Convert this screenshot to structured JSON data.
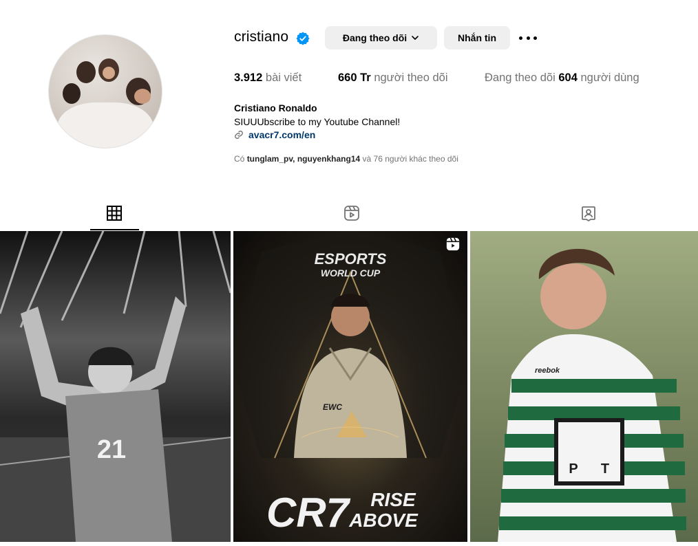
{
  "profile": {
    "username": "cristiano",
    "verified": true,
    "buttons": {
      "following": "Đang theo dõi",
      "message": "Nhắn tin"
    },
    "stats": {
      "posts_count": "3.912",
      "posts_label": "bài viết",
      "followers_count": "660 Tr",
      "followers_label": "người theo dõi",
      "following_prefix": "Đang theo dõi",
      "following_count": "604",
      "following_label": "người dùng"
    },
    "full_name": "Cristiano Ronaldo",
    "bio": "SIUUUbscribe to my Youtube Channel!",
    "link": "avacr7.com/en",
    "followed_by": {
      "prefix": "Có",
      "user1": "tunglam_pv",
      "sep": ",",
      "user2": "nguyenkhang14",
      "suffix": "và 76 người khác theo dõi"
    }
  },
  "tabs": [
    {
      "name": "posts",
      "icon": "grid-icon",
      "active": true
    },
    {
      "name": "reels",
      "icon": "reels-icon",
      "active": false
    },
    {
      "name": "tagged",
      "icon": "tagged-icon",
      "active": false
    }
  ],
  "grid": [
    {
      "type": "photo",
      "jersey_number": "21"
    },
    {
      "type": "reel",
      "header": "ESPORTS",
      "subheader": "WORLD CUP",
      "logo_text": "EWC",
      "big_text": "CR7",
      "tagline1": "RISE",
      "tagline2": "ABOVE"
    },
    {
      "type": "photo",
      "brand_text": "reebok",
      "sponsor_letters": [
        "P",
        "T"
      ]
    }
  ],
  "colors": {
    "accent_link": "#00376b",
    "verified_blue": "#0095f6",
    "button_bg": "#efefef",
    "muted_text": "#737373"
  }
}
